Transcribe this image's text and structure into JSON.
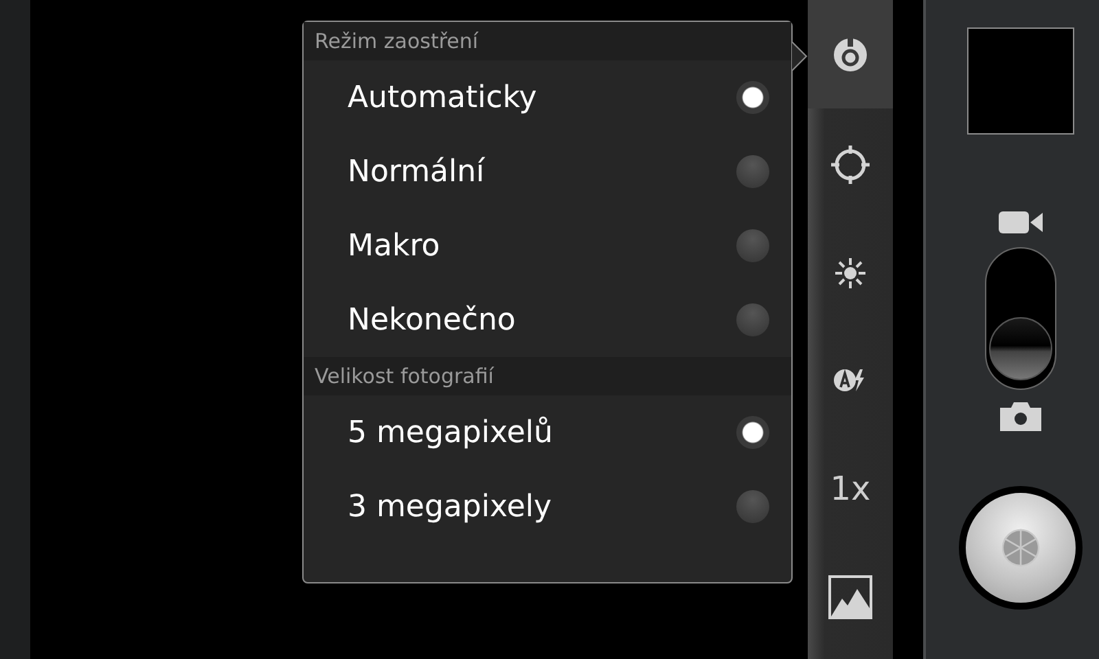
{
  "settings_popup": {
    "sections": [
      {
        "header": "Režim zaostření",
        "options": [
          {
            "label": "Automaticky",
            "selected": true
          },
          {
            "label": "Normální",
            "selected": false
          },
          {
            "label": "Makro",
            "selected": false
          },
          {
            "label": "Nekonečno",
            "selected": false
          }
        ]
      },
      {
        "header": "Velikost fotografií",
        "options": [
          {
            "label": "5 megapixelů",
            "selected": true
          },
          {
            "label": "3 megapixely",
            "selected": false
          }
        ]
      }
    ]
  },
  "settings_bar": [
    {
      "kind": "focus",
      "selected": true
    },
    {
      "kind": "exposure",
      "selected": false
    },
    {
      "kind": "white_balance",
      "selected": false
    },
    {
      "kind": "flash",
      "selected": false
    },
    {
      "kind": "zoom",
      "label": "1x",
      "selected": false
    },
    {
      "kind": "scene",
      "selected": false
    }
  ],
  "mode_switch": {
    "photo_selected": true
  }
}
